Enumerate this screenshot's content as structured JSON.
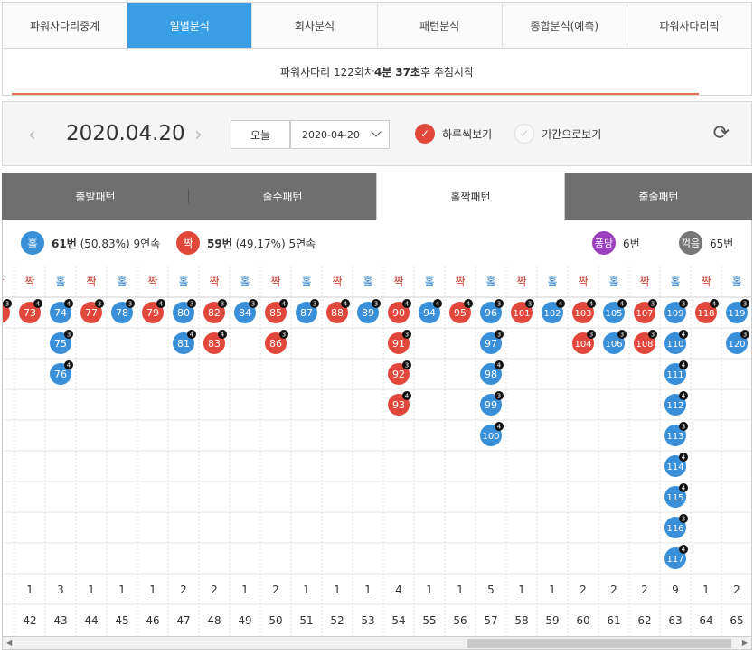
{
  "nav": {
    "tabs": [
      "파워사다리중계",
      "일별분석",
      "회차분석",
      "패턴분석",
      "종합분석(예측)",
      "파워사다리픽"
    ],
    "active_index": 1
  },
  "notice": {
    "prefix": "파워사다리 122회차 ",
    "minutes": "4분",
    "seconds": "37초",
    "suffix": "후 추첨시작"
  },
  "datebar": {
    "date": "2020.04.20",
    "today_label": "오늘",
    "select_value": "2020-04-20",
    "daily_label": "하루씩보기",
    "period_label": "기간으로보기"
  },
  "pattern_tabs": {
    "tabs": [
      "출발패턴",
      "줄수패턴",
      "홀짝패턴",
      "출줄패턴"
    ],
    "active_index": 2
  },
  "stats": {
    "odd_ball": "홀",
    "odd_count": "61번",
    "odd_detail": "(50,83%) 9연속",
    "even_ball": "짝",
    "even_count": "59번",
    "even_detail": "(49,17%) 5연속",
    "pong_ball": "퐁당",
    "pong_count": "6번",
    "kkeok_ball": "꺽음",
    "kkeok_count": "65번"
  },
  "colors": {
    "odd": "#3a8fd9",
    "even": "#e2473b",
    "pong": "#9b3fbf",
    "kkeok": "#777777",
    "accent": "#3a9ee4"
  },
  "grid": {
    "labels": {
      "odd": "홀",
      "even": "짝"
    },
    "columns": [
      {
        "type": "짝",
        "balls": [
          {
            "n": "",
            "tag": "3"
          }
        ],
        "count": "",
        "idx": ""
      },
      {
        "type": "짝",
        "balls": [
          {
            "n": "73",
            "tag": "4"
          }
        ],
        "count": "1",
        "idx": "42"
      },
      {
        "type": "홀",
        "balls": [
          {
            "n": "74",
            "tag": "4"
          },
          {
            "n": "75",
            "tag": "3"
          },
          {
            "n": "76",
            "tag": "4"
          }
        ],
        "count": "3",
        "idx": "43"
      },
      {
        "type": "짝",
        "balls": [
          {
            "n": "77",
            "tag": "3"
          }
        ],
        "count": "1",
        "idx": "44"
      },
      {
        "type": "홀",
        "balls": [
          {
            "n": "78",
            "tag": "3"
          }
        ],
        "count": "1",
        "idx": "45"
      },
      {
        "type": "짝",
        "balls": [
          {
            "n": "79",
            "tag": "4"
          }
        ],
        "count": "1",
        "idx": "46"
      },
      {
        "type": "홀",
        "balls": [
          {
            "n": "80",
            "tag": "3"
          },
          {
            "n": "81",
            "tag": "4"
          }
        ],
        "count": "2",
        "idx": "47"
      },
      {
        "type": "짝",
        "balls": [
          {
            "n": "82",
            "tag": "3"
          },
          {
            "n": "83",
            "tag": "4"
          }
        ],
        "count": "2",
        "idx": "48"
      },
      {
        "type": "홀",
        "balls": [
          {
            "n": "84",
            "tag": "3"
          }
        ],
        "count": "1",
        "idx": "49"
      },
      {
        "type": "짝",
        "balls": [
          {
            "n": "85",
            "tag": "4"
          },
          {
            "n": "86",
            "tag": "3"
          }
        ],
        "count": "2",
        "idx": "50"
      },
      {
        "type": "홀",
        "balls": [
          {
            "n": "87",
            "tag": "3"
          }
        ],
        "count": "1",
        "idx": "51"
      },
      {
        "type": "짝",
        "balls": [
          {
            "n": "88",
            "tag": "4"
          }
        ],
        "count": "1",
        "idx": "52"
      },
      {
        "type": "홀",
        "balls": [
          {
            "n": "89",
            "tag": "3"
          }
        ],
        "count": "1",
        "idx": "53"
      },
      {
        "type": "짝",
        "balls": [
          {
            "n": "90",
            "tag": "4"
          },
          {
            "n": "91",
            "tag": "3"
          },
          {
            "n": "92",
            "tag": "3"
          },
          {
            "n": "93",
            "tag": "4"
          }
        ],
        "count": "4",
        "idx": "54"
      },
      {
        "type": "홀",
        "balls": [
          {
            "n": "94",
            "tag": "4"
          }
        ],
        "count": "1",
        "idx": "55"
      },
      {
        "type": "짝",
        "balls": [
          {
            "n": "95",
            "tag": "4"
          }
        ],
        "count": "1",
        "idx": "56"
      },
      {
        "type": "홀",
        "balls": [
          {
            "n": "96",
            "tag": "3"
          },
          {
            "n": "97",
            "tag": "3"
          },
          {
            "n": "98",
            "tag": "4"
          },
          {
            "n": "99",
            "tag": "3"
          },
          {
            "n": "100",
            "tag": "4"
          }
        ],
        "count": "5",
        "idx": "57"
      },
      {
        "type": "짝",
        "balls": [
          {
            "n": "101",
            "tag": "3"
          }
        ],
        "count": "1",
        "idx": "58"
      },
      {
        "type": "홀",
        "balls": [
          {
            "n": "102",
            "tag": "4"
          }
        ],
        "count": "1",
        "idx": "59"
      },
      {
        "type": "짝",
        "balls": [
          {
            "n": "103",
            "tag": "4"
          },
          {
            "n": "104",
            "tag": "3"
          }
        ],
        "count": "2",
        "idx": "60"
      },
      {
        "type": "홀",
        "balls": [
          {
            "n": "105",
            "tag": "4"
          },
          {
            "n": "106",
            "tag": "3"
          }
        ],
        "count": "2",
        "idx": "61"
      },
      {
        "type": "짝",
        "balls": [
          {
            "n": "107",
            "tag": "3"
          },
          {
            "n": "108",
            "tag": "3"
          }
        ],
        "count": "2",
        "idx": "62"
      },
      {
        "type": "홀",
        "balls": [
          {
            "n": "109",
            "tag": "3"
          },
          {
            "n": "110",
            "tag": "4"
          },
          {
            "n": "111",
            "tag": "4"
          },
          {
            "n": "112",
            "tag": "4"
          },
          {
            "n": "113",
            "tag": "3"
          },
          {
            "n": "114",
            "tag": "4"
          },
          {
            "n": "115",
            "tag": "4"
          },
          {
            "n": "116",
            "tag": "3"
          },
          {
            "n": "117",
            "tag": "4"
          }
        ],
        "count": "9",
        "idx": "63"
      },
      {
        "type": "짝",
        "balls": [
          {
            "n": "118",
            "tag": "4"
          }
        ],
        "count": "1",
        "idx": "64"
      },
      {
        "type": "홀",
        "balls": [
          {
            "n": "119",
            "tag": "3"
          },
          {
            "n": "120",
            "tag": "3"
          }
        ],
        "count": "2",
        "idx": "65"
      }
    ]
  }
}
